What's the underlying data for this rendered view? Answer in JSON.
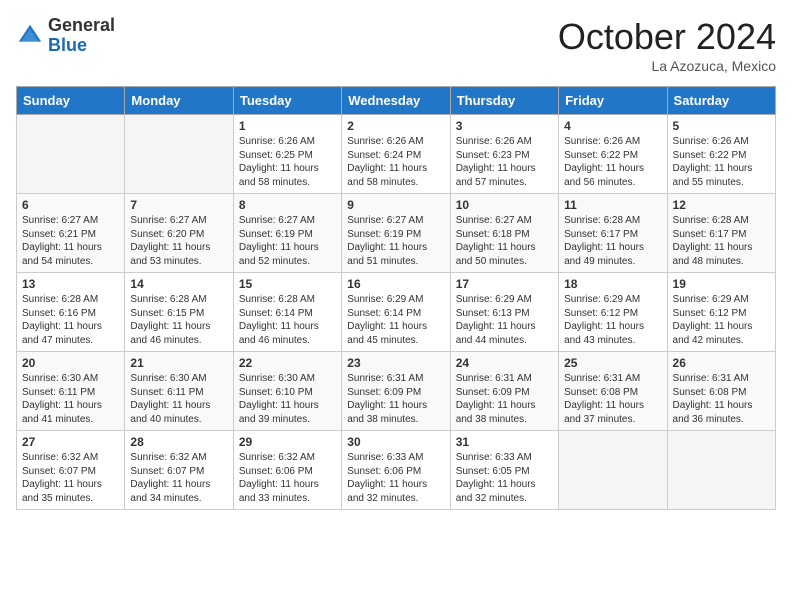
{
  "header": {
    "logo_line1": "General",
    "logo_line2": "Blue",
    "month": "October 2024",
    "location": "La Azozuca, Mexico"
  },
  "days_of_week": [
    "Sunday",
    "Monday",
    "Tuesday",
    "Wednesday",
    "Thursday",
    "Friday",
    "Saturday"
  ],
  "weeks": [
    [
      {
        "day": "",
        "empty": true
      },
      {
        "day": "",
        "empty": true
      },
      {
        "day": "1",
        "sunrise": "6:26 AM",
        "sunset": "6:25 PM",
        "daylight": "11 hours and 58 minutes."
      },
      {
        "day": "2",
        "sunrise": "6:26 AM",
        "sunset": "6:24 PM",
        "daylight": "11 hours and 58 minutes."
      },
      {
        "day": "3",
        "sunrise": "6:26 AM",
        "sunset": "6:23 PM",
        "daylight": "11 hours and 57 minutes."
      },
      {
        "day": "4",
        "sunrise": "6:26 AM",
        "sunset": "6:22 PM",
        "daylight": "11 hours and 56 minutes."
      },
      {
        "day": "5",
        "sunrise": "6:26 AM",
        "sunset": "6:22 PM",
        "daylight": "11 hours and 55 minutes."
      }
    ],
    [
      {
        "day": "6",
        "sunrise": "6:27 AM",
        "sunset": "6:21 PM",
        "daylight": "11 hours and 54 minutes."
      },
      {
        "day": "7",
        "sunrise": "6:27 AM",
        "sunset": "6:20 PM",
        "daylight": "11 hours and 53 minutes."
      },
      {
        "day": "8",
        "sunrise": "6:27 AM",
        "sunset": "6:19 PM",
        "daylight": "11 hours and 52 minutes."
      },
      {
        "day": "9",
        "sunrise": "6:27 AM",
        "sunset": "6:19 PM",
        "daylight": "11 hours and 51 minutes."
      },
      {
        "day": "10",
        "sunrise": "6:27 AM",
        "sunset": "6:18 PM",
        "daylight": "11 hours and 50 minutes."
      },
      {
        "day": "11",
        "sunrise": "6:28 AM",
        "sunset": "6:17 PM",
        "daylight": "11 hours and 49 minutes."
      },
      {
        "day": "12",
        "sunrise": "6:28 AM",
        "sunset": "6:17 PM",
        "daylight": "11 hours and 48 minutes."
      }
    ],
    [
      {
        "day": "13",
        "sunrise": "6:28 AM",
        "sunset": "6:16 PM",
        "daylight": "11 hours and 47 minutes."
      },
      {
        "day": "14",
        "sunrise": "6:28 AM",
        "sunset": "6:15 PM",
        "daylight": "11 hours and 46 minutes."
      },
      {
        "day": "15",
        "sunrise": "6:28 AM",
        "sunset": "6:14 PM",
        "daylight": "11 hours and 46 minutes."
      },
      {
        "day": "16",
        "sunrise": "6:29 AM",
        "sunset": "6:14 PM",
        "daylight": "11 hours and 45 minutes."
      },
      {
        "day": "17",
        "sunrise": "6:29 AM",
        "sunset": "6:13 PM",
        "daylight": "11 hours and 44 minutes."
      },
      {
        "day": "18",
        "sunrise": "6:29 AM",
        "sunset": "6:12 PM",
        "daylight": "11 hours and 43 minutes."
      },
      {
        "day": "19",
        "sunrise": "6:29 AM",
        "sunset": "6:12 PM",
        "daylight": "11 hours and 42 minutes."
      }
    ],
    [
      {
        "day": "20",
        "sunrise": "6:30 AM",
        "sunset": "6:11 PM",
        "daylight": "11 hours and 41 minutes."
      },
      {
        "day": "21",
        "sunrise": "6:30 AM",
        "sunset": "6:11 PM",
        "daylight": "11 hours and 40 minutes."
      },
      {
        "day": "22",
        "sunrise": "6:30 AM",
        "sunset": "6:10 PM",
        "daylight": "11 hours and 39 minutes."
      },
      {
        "day": "23",
        "sunrise": "6:31 AM",
        "sunset": "6:09 PM",
        "daylight": "11 hours and 38 minutes."
      },
      {
        "day": "24",
        "sunrise": "6:31 AM",
        "sunset": "6:09 PM",
        "daylight": "11 hours and 38 minutes."
      },
      {
        "day": "25",
        "sunrise": "6:31 AM",
        "sunset": "6:08 PM",
        "daylight": "11 hours and 37 minutes."
      },
      {
        "day": "26",
        "sunrise": "6:31 AM",
        "sunset": "6:08 PM",
        "daylight": "11 hours and 36 minutes."
      }
    ],
    [
      {
        "day": "27",
        "sunrise": "6:32 AM",
        "sunset": "6:07 PM",
        "daylight": "11 hours and 35 minutes."
      },
      {
        "day": "28",
        "sunrise": "6:32 AM",
        "sunset": "6:07 PM",
        "daylight": "11 hours and 34 minutes."
      },
      {
        "day": "29",
        "sunrise": "6:32 AM",
        "sunset": "6:06 PM",
        "daylight": "11 hours and 33 minutes."
      },
      {
        "day": "30",
        "sunrise": "6:33 AM",
        "sunset": "6:06 PM",
        "daylight": "11 hours and 32 minutes."
      },
      {
        "day": "31",
        "sunrise": "6:33 AM",
        "sunset": "6:05 PM",
        "daylight": "11 hours and 32 minutes."
      },
      {
        "day": "",
        "empty": true
      },
      {
        "day": "",
        "empty": true
      }
    ]
  ]
}
